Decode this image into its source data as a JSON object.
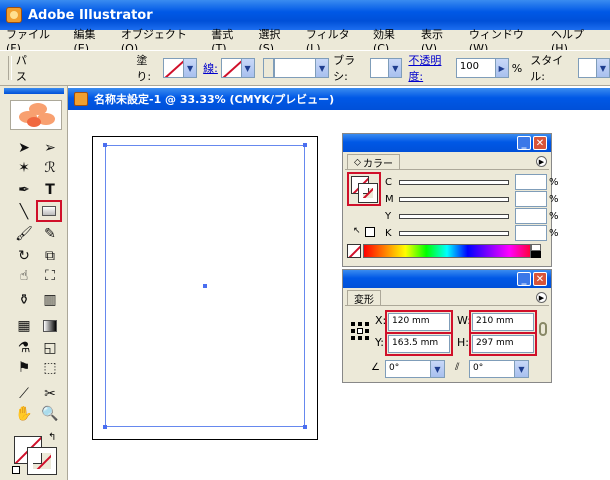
{
  "window": {
    "title": "Adobe Illustrator"
  },
  "menu": [
    "ファイル(F)",
    "編集(E)",
    "オブジェクト(O)",
    "書式(T)",
    "選択(S)",
    "フィルタ(L)",
    "効果(C)",
    "表示(V)",
    "ウィンドウ(W)",
    "ヘルプ(H)"
  ],
  "control_bar": {
    "path_label": "パス",
    "fill_label": "塗り:",
    "stroke_label": "線:",
    "brush_label": "ブラシ:",
    "opacity_label": "不透明度:",
    "opacity_value": "100",
    "opacity_unit": "%",
    "style_label": "スタイル:"
  },
  "document": {
    "title": "名称未設定-1 @ 33.33% (CMYK/プレビュー)"
  },
  "color_panel": {
    "tab": "カラー",
    "channels": [
      "C",
      "M",
      "Y",
      "K"
    ],
    "percent": "%"
  },
  "transform_panel": {
    "tab": "変形",
    "x_label": "X:",
    "x_value": "120 mm",
    "y_label": "Y:",
    "y_value": "163.5 mm",
    "w_label": "W:",
    "w_value": "210 mm",
    "h_label": "H:",
    "h_value": "297 mm",
    "rotate_value": "0°",
    "shear_value": "0°"
  },
  "colors": {
    "titlebar": "#0058e6",
    "highlight": "#d0102a",
    "chrome": "#ece9d8"
  }
}
